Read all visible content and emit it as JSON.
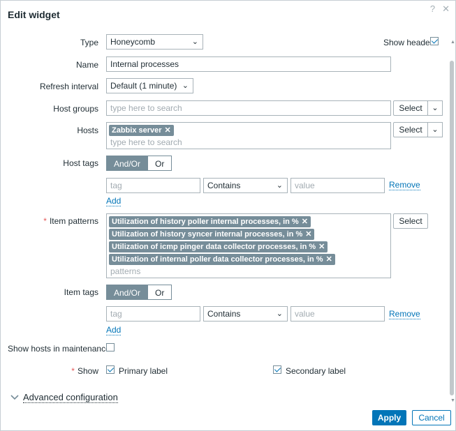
{
  "dialog": {
    "title": "Edit widget"
  },
  "form": {
    "type": {
      "label": "Type",
      "value": "Honeycomb"
    },
    "show_header": {
      "label": "Show header",
      "checked": true
    },
    "name": {
      "label": "Name",
      "value": "Internal processes"
    },
    "refresh": {
      "label": "Refresh interval",
      "value": "Default (1 minute)"
    },
    "host_groups": {
      "label": "Host groups",
      "placeholder": "type here to search",
      "select": "Select"
    },
    "hosts": {
      "label": "Hosts",
      "tags": [
        "Zabbix server"
      ],
      "placeholder": "type here to search",
      "select": "Select"
    },
    "host_tags": {
      "label": "Host tags",
      "and_or": "And/Or",
      "or": "Or",
      "tag_placeholder": "tag",
      "operator": "Contains",
      "value_placeholder": "value",
      "remove": "Remove",
      "add": "Add"
    },
    "item_patterns": {
      "label": "Item patterns",
      "required": "*",
      "tags": [
        "Utilization of history poller internal processes, in %",
        "Utilization of history syncer internal processes, in %",
        "Utilization of icmp pinger data collector processes, in %",
        "Utilization of internal poller data collector processes, in %"
      ],
      "placeholder": "patterns",
      "select": "Select"
    },
    "item_tags": {
      "label": "Item tags",
      "and_or": "And/Or",
      "or": "Or",
      "tag_placeholder": "tag",
      "operator": "Contains",
      "value_placeholder": "value",
      "remove": "Remove",
      "add": "Add"
    },
    "maintenance": {
      "label": "Show hosts in maintenance",
      "checked": false
    },
    "show": {
      "label": "Show",
      "required": "*",
      "primary": "Primary label",
      "secondary": "Secondary label"
    },
    "advanced": {
      "label": "Advanced configuration"
    }
  },
  "footer": {
    "apply": "Apply",
    "cancel": "Cancel"
  },
  "icons": {
    "help": "?",
    "close": "✕",
    "tag_remove": "✕"
  }
}
